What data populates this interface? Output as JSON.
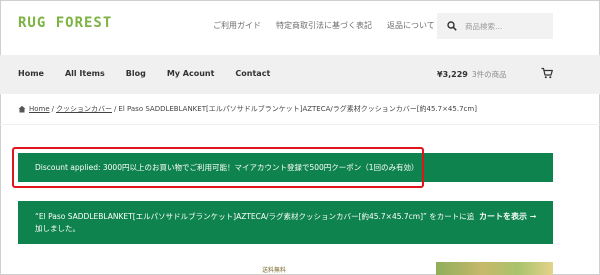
{
  "header": {
    "logo": "RUG FOREST",
    "top_links": [
      "ご利用ガイド",
      "特定商取引法に基づく表記",
      "返品について"
    ],
    "search": {
      "placeholder": "商品検索…"
    }
  },
  "nav": {
    "items": [
      "Home",
      "All Items",
      "Blog",
      "My Acount",
      "Contact"
    ]
  },
  "cart": {
    "amount": "¥3,229",
    "count": "3件の商品"
  },
  "breadcrumb": {
    "home": "Home",
    "category": "クッションカバー",
    "current": "El Paso SADDLEBLANKET[エルパソサドルブランケット]AZTECA/ラグ素材クッションカバー[約45.7×45.7cm]"
  },
  "notices": {
    "discount": "Discount applied: 3000円以上のお買い物でご利用可能！マイアカウント登録で500円クーポン（1回のみ有効）",
    "added": "“El Paso SADDLEBLANKET[エルパソサドルブランケット]AZTECA/ラグ素材クッションカバー[約45.7×45.7cm]” をカートに追加しました。",
    "view_cart": "カートを表示 ➞"
  },
  "bottom": {
    "partial_text": "送料無料"
  },
  "colors": {
    "accent_green": "#0f834d",
    "highlight_red": "#e0141c",
    "logo_green": "#7cb342"
  }
}
